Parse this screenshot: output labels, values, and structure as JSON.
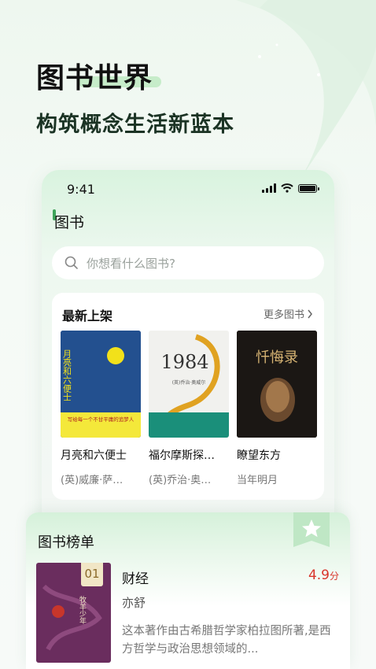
{
  "hero": {
    "title": "图书世界",
    "subtitle": "构筑概念生活新蓝本"
  },
  "phone": {
    "status_time": "9:41",
    "page_title": "图书",
    "search_placeholder": "你想看什么图书?",
    "new_books": {
      "title": "最新上架",
      "more_label": "更多图书",
      "items": [
        {
          "title": "月亮和六便士",
          "author": "(英)威廉·萨…",
          "cover_text": "月亮和六便士",
          "cover_blurb": "写给每一个不甘平庸的追梦人"
        },
        {
          "title": "福尔摩斯探…",
          "author": "(英)乔治·奥…",
          "cover_text": "1984",
          "cover_blurb": "(英)乔治·奥威尔"
        },
        {
          "title": "瞭望东方",
          "author": "当年明月",
          "cover_text": "忏悔录",
          "cover_blurb": ""
        }
      ]
    }
  },
  "ranking": {
    "title": "图书榜单",
    "item": {
      "rank": "01",
      "name": "财经",
      "score": "4.9",
      "score_unit": "分",
      "author": "亦舒",
      "description": "这本著作由古希腊哲学家柏拉图所著,是西方哲学与政治思想领域的...",
      "cover_text": "牧羊少年"
    }
  },
  "colors": {
    "accent": "#3ea45a",
    "score": "#d9342b"
  }
}
